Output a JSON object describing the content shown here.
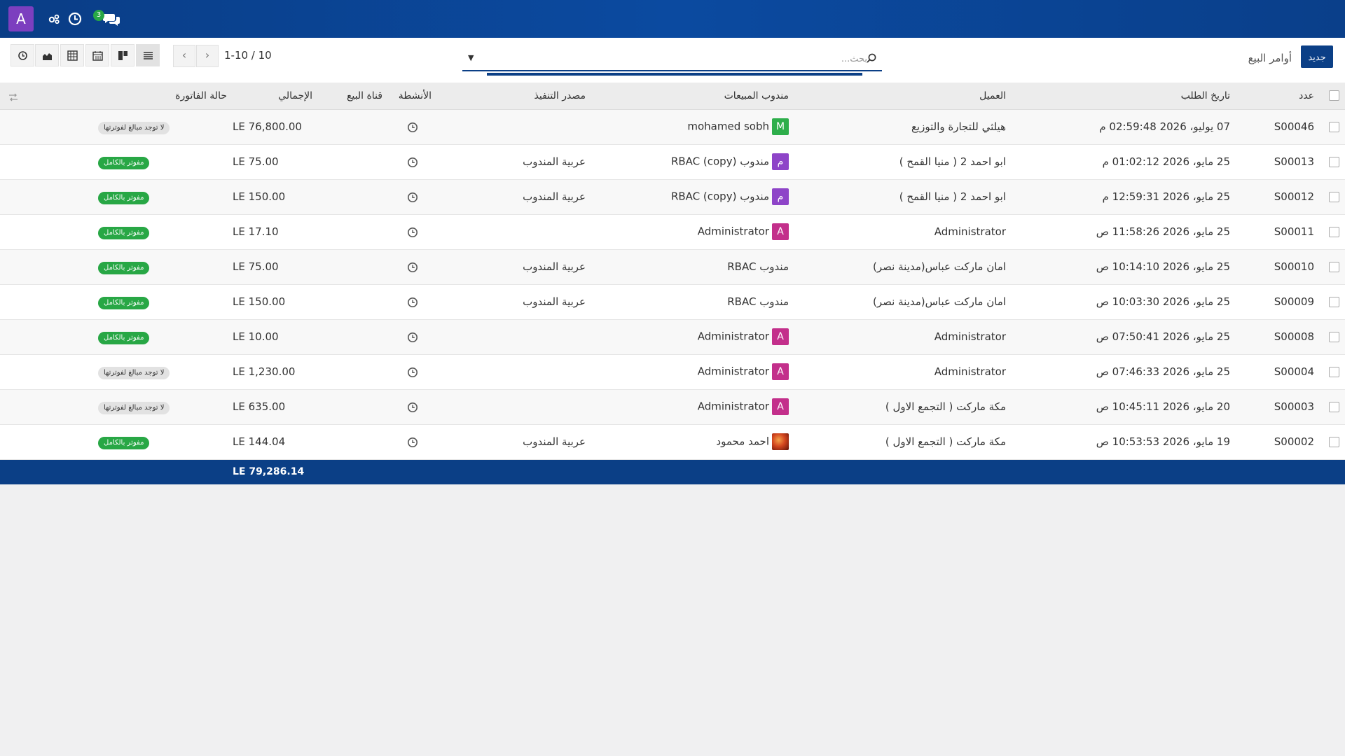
{
  "navbar": {
    "user_initial": "A",
    "messages_count": "3",
    "icons": [
      "activity-icon",
      "clock-icon",
      "messages-icon"
    ]
  },
  "control_panel": {
    "new_label": "جديد",
    "breadcrumb": "أوامر البيع",
    "search_placeholder": "بحث...",
    "pager_value": "1-10 / 10",
    "views": [
      "list-view",
      "kanban-view",
      "calendar-view",
      "pivot-view",
      "graph-view",
      "activity-view"
    ]
  },
  "columns": {
    "number": "عدد",
    "order_date": "تاريخ الطلب",
    "customer": "العميل",
    "salesperson": "مندوب المبيعات",
    "source": "مصدر التنفيذ",
    "activities": "الأنشطة",
    "channel": "قناة البيع",
    "total": "الإجمالي",
    "invoice_status": "حالة الفاتورة"
  },
  "rows": [
    {
      "number": "S00046",
      "date": "07 يوليو، 2026 02:59:48 م",
      "customer": "هيلثي للتجارة والتوزيع",
      "sp_avatar": "M",
      "sp_color": "green",
      "salesperson": "mohamed sobh",
      "source": "",
      "channel": "",
      "total": "76,800.00 LE",
      "status": "لا توجد مبالغ لفوترتها",
      "status_type": "muted"
    },
    {
      "number": "S00013",
      "date": "25 مايو، 2026 01:02:12 م",
      "customer": "ابو احمد 2 ( منيا القمح )",
      "sp_avatar": "م",
      "sp_color": "purple",
      "salesperson": "مندوب RBAC (copy)",
      "source": "عربية المندوب",
      "channel": "",
      "total": "75.00 LE",
      "status": "مفوتر بالكامل",
      "status_type": "success"
    },
    {
      "number": "S00012",
      "date": "25 مايو، 2026 12:59:31 م",
      "customer": "ابو احمد 2 ( منيا القمح )",
      "sp_avatar": "م",
      "sp_color": "purple",
      "salesperson": "مندوب RBAC (copy)",
      "source": "عربية المندوب",
      "channel": "",
      "total": "150.00 LE",
      "status": "مفوتر بالكامل",
      "status_type": "success"
    },
    {
      "number": "S00011",
      "date": "25 مايو، 2026 11:58:26 ص",
      "customer": "Administrator",
      "sp_avatar": "A",
      "sp_color": "pink",
      "salesperson": "Administrator",
      "source": "",
      "channel": "",
      "total": "17.10 LE",
      "status": "مفوتر بالكامل",
      "status_type": "success"
    },
    {
      "number": "S00010",
      "date": "25 مايو، 2026 10:14:10 ص",
      "customer": "امان ماركت عباس(مدينة نصر)",
      "sp_avatar": "",
      "sp_color": "",
      "salesperson": "مندوب RBAC",
      "source": "عربية المندوب",
      "channel": "",
      "total": "75.00 LE",
      "status": "مفوتر بالكامل",
      "status_type": "success"
    },
    {
      "number": "S00009",
      "date": "25 مايو، 2026 10:03:30 ص",
      "customer": "امان ماركت عباس(مدينة نصر)",
      "sp_avatar": "",
      "sp_color": "",
      "salesperson": "مندوب RBAC",
      "source": "عربية المندوب",
      "channel": "",
      "total": "150.00 LE",
      "status": "مفوتر بالكامل",
      "status_type": "success"
    },
    {
      "number": "S00008",
      "date": "25 مايو، 2026 07:50:41 ص",
      "customer": "Administrator",
      "sp_avatar": "A",
      "sp_color": "pink",
      "salesperson": "Administrator",
      "source": "",
      "channel": "",
      "total": "10.00 LE",
      "status": "مفوتر بالكامل",
      "status_type": "success"
    },
    {
      "number": "S00004",
      "date": "25 مايو، 2026 07:46:33 ص",
      "customer": "Administrator",
      "sp_avatar": "A",
      "sp_color": "pink",
      "salesperson": "Administrator",
      "source": "",
      "channel": "",
      "total": "1,230.00 LE",
      "status": "لا توجد مبالغ لفوترتها",
      "status_type": "muted"
    },
    {
      "number": "S00003",
      "date": "20 مايو، 2026 10:45:11 ص",
      "customer": "مكة ماركت ( التجمع الاول )",
      "sp_avatar": "A",
      "sp_color": "pink",
      "salesperson": "Administrator",
      "source": "",
      "channel": "",
      "total": "635.00 LE",
      "status": "لا توجد مبالغ لفوترتها",
      "status_type": "muted"
    },
    {
      "number": "S00002",
      "date": "19 مايو، 2026 10:53:53 ص",
      "customer": "مكة ماركت ( التجمع الاول )",
      "sp_avatar": "img",
      "sp_color": "img",
      "salesperson": "احمد محمود",
      "source": "عربية المندوب",
      "channel": "",
      "total": "144.04 LE",
      "status": "مفوتر بالكامل",
      "status_type": "success"
    }
  ],
  "footer": {
    "grand_total": "79,286.14 LE"
  },
  "colors": {
    "navbar": "#0b4aa0",
    "primary": "#0b3f86",
    "success": "#28a745"
  }
}
